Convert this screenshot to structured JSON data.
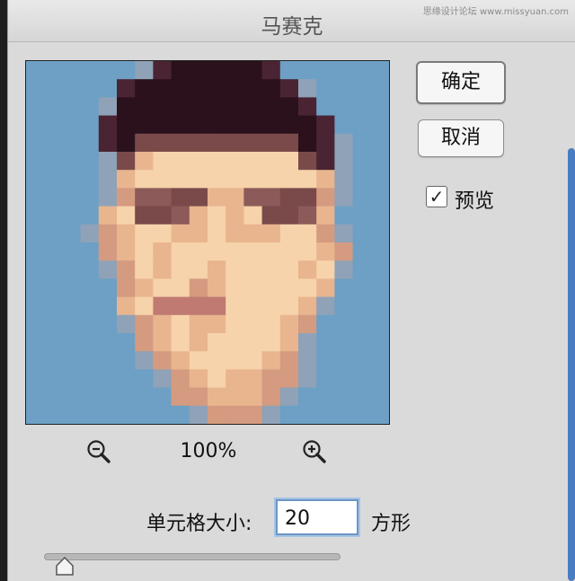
{
  "dialog": {
    "title": "马赛克",
    "watermark": "思缘设计论坛 www.missyuan.com"
  },
  "buttons": {
    "ok_label": "确定",
    "cancel_label": "取消"
  },
  "preview": {
    "label": "预览",
    "checked": true,
    "check_glyph": "✓",
    "zoom_level": "100%",
    "zoom_out_icon": "zoom-out-magnifier",
    "zoom_in_icon": "zoom-in-magnifier"
  },
  "cell_size": {
    "label": "单元格大小:",
    "value": "20",
    "unit": "方形",
    "slider_fraction": 0.07
  },
  "mosaic": {
    "columns": 20,
    "rows": 20,
    "palette": {
      "b": "#6da0c4",
      "g": "#8fa2b7",
      "h": "#2b111c",
      "d": "#4a2433",
      "m": "#7a4a4a",
      "s": "#e8b58f",
      "l": "#f6d3aa",
      "t": "#d49b80",
      "e": "#8c5a58",
      "r": "#c07a72",
      "p": "#d9a79a"
    },
    "grid": [
      "bbbbbbgdhhhhhdbbbbbb",
      "bbbbbdhhhhhhhhdgbbbb",
      "bbbbghhhhhhhhhhdbbbb",
      "bbbbdhhhhhhhhhhhdbbb",
      "bbbbdhmmmmmmmmmhdgbb",
      "bbbbgmsllllllllmdgbb",
      "bbbbgsllllllllllsgbb",
      "bbbbgteemmsseemmtgbb",
      "bbbbslmmeslslmmesbbb",
      "bbbgtsllsslssslltgbb",
      "bbbbtslsllllllllstbb",
      "bbbbgtlsllsllllslgbb",
      "bbbbbtslltslllllsbbb",
      "bbbbbslrrrrllllsgbbb",
      "bbbbbgtslsslllstbbbb",
      "bbbbbbtslsllllsgbbbb",
      "bbbbbbgtsllllstgbbbb",
      "bbbbbbbgtslssttgbbbb",
      "bbbbbbbbttssstgbbbbb",
      "bbbbbbbbbgtttgbbbbbb"
    ]
  }
}
